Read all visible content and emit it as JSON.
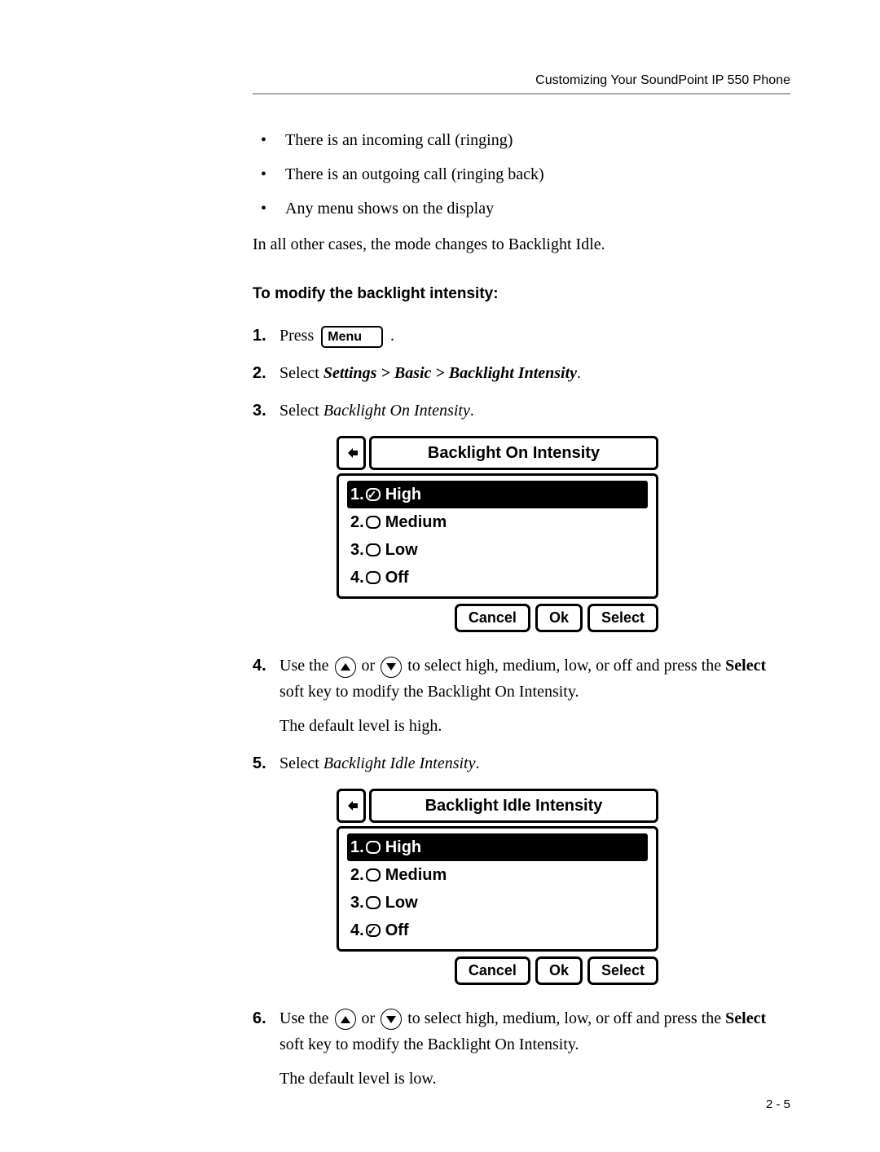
{
  "header": {
    "running_head": "Customizing Your SoundPoint IP 550 Phone"
  },
  "intro_bullets": [
    "There is an incoming call (ringing)",
    "There is an outgoing call (ringing back)",
    "Any menu shows on the display"
  ],
  "intro_followup": "In all other cases, the mode changes to Backlight Idle.",
  "section_heading": "To modify the backlight intensity:",
  "steps": {
    "s1": {
      "before": "Press ",
      "key_label": "Menu",
      "after": " ."
    },
    "s2": {
      "before": "Select ",
      "path": "Settings > Basic > Backlight Intensity",
      "after": "."
    },
    "s3": {
      "before": "Select ",
      "item": "Backlight On Intensity",
      "after": "."
    },
    "s4": {
      "part1a": "Use the ",
      "part1b": " or ",
      "part1c": " to select high, medium, low, or off and press the ",
      "select_word": "Select",
      "part1d": " soft key to modify the Backlight On Intensity.",
      "part2": "The default level is high."
    },
    "s5": {
      "before": "Select ",
      "item": "Backlight Idle Intensity",
      "after": "."
    },
    "s6": {
      "part1a": "Use the ",
      "part1b": " or ",
      "part1c": " to select high, medium, low, or off and press the ",
      "select_word": "Select",
      "part1d": " soft key to modify the Backlight On Intensity.",
      "part2": "The default level is low."
    }
  },
  "lcd1": {
    "title": "Backlight On Intensity",
    "rows": [
      {
        "num": "1.",
        "label": "High",
        "checked": true,
        "selected": true
      },
      {
        "num": "2.",
        "label": "Medium",
        "checked": false,
        "selected": false
      },
      {
        "num": "3.",
        "label": "Low",
        "checked": false,
        "selected": false
      },
      {
        "num": "4.",
        "label": "Off",
        "checked": false,
        "selected": false
      }
    ],
    "softkeys": [
      "Cancel",
      "Ok",
      "Select"
    ]
  },
  "lcd2": {
    "title": "Backlight Idle Intensity",
    "rows": [
      {
        "num": "1.",
        "label": "High",
        "checked": false,
        "selected": true
      },
      {
        "num": "2.",
        "label": "Medium",
        "checked": false,
        "selected": false
      },
      {
        "num": "3.",
        "label": "Low",
        "checked": false,
        "selected": false
      },
      {
        "num": "4.",
        "label": "Off",
        "checked": true,
        "selected": false
      }
    ],
    "softkeys": [
      "Cancel",
      "Ok",
      "Select"
    ]
  },
  "page_number": "2 - 5"
}
